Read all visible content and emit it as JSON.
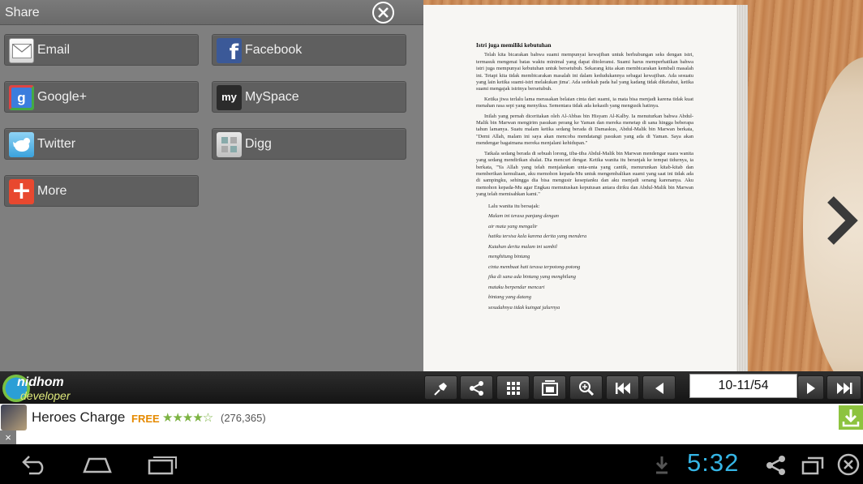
{
  "share_panel": {
    "title": "Share",
    "items": [
      {
        "label": "Email",
        "icon": "email-icon"
      },
      {
        "label": "Facebook",
        "icon": "facebook-icon"
      },
      {
        "label": "Google+",
        "icon": "google-plus-icon"
      },
      {
        "label": "MySpace",
        "icon": "myspace-icon"
      },
      {
        "label": "Twitter",
        "icon": "twitter-icon"
      },
      {
        "label": "Digg",
        "icon": "digg-icon"
      },
      {
        "label": "More",
        "icon": "plus-icon"
      }
    ],
    "icon_glyphs": {
      "facebook": "f",
      "google_plus": "g",
      "myspace": "my",
      "more": "+"
    }
  },
  "book": {
    "heading": "Istri juga memiliki kebutuhan",
    "paragraphs": [
      "Telah kita bicarakan bahwa suami mempunyai kewajiban untuk berhubungan seks dengan istri, termasuk mengenai batas waktu minimal yang dapat ditoleransi. Suami harus memperhatikan bahwa istri juga mempunyai kebutuhan untuk bersetubuh. Sekarang kita akan membicarakan kembali masalah ini. Tetapi kita tidak membicarakan masalah ini dalam kedudukannya sebagai kewajiban. Ada sesuatu yang lain ketika suami-istri melakukan jima'. Ada sedekah pada hal yang kadang tidak diketahui, ketika suami mengajak istrinya bersetubuh.",
      "Ketika jiwa terlalu lama merasakan belaian cinta dari suami, ia mata bisa menjadi karena tidak kuat menahan rasa sepi yang menyiksa. Sementara tidak ada kekasih yang mengusik hatinya.",
      "Inilah yang pernah diceritakan oleh Al-Abbas bin Hisyam Al-Kalby. Ia menuturkan bahwa Abdul-Malik bin Marwan mengirim pasukan perang ke Yaman dan mereka menetap di sana hingga beberapa tahun lamanya. Suatu malam ketika sedang berada di Damaskus, Abdul-Malik bin Marwan berkata, \"Demi Allah, malam ini saya akan mencoba mendatangi pasukan yang ada di Yaman. Saya akan mendengar bagaimana mereka menjalani kehidupan.\"",
      "Tatkala sedang berada di sebuah lorong, tiba-tiba Abdul-Malik bin Marwan mendengar suara wanita yang sedang mendirikan shalat. Dia mencuri dengar. Ketika wanita itu beranjak ke tempat tidurnya, ia berkata, \"Ya Allah yang telah menjalankan unta-unta yang cantik, menurunkan kitab-kitab dan memberikan kemuliaan, aku memohon kepada-Mu untuk mengembalikan suami yang saat ini tidak ada di sampingku, sehingga dia bisa mengusir kesepianku dan aku menjadi senang karenanya. Aku memohon kepada-Mu agar Engkau memutuskan keputusan antara diriku dan Abdul-Malik bin Marwan yang telah memisahkan kami.\""
    ],
    "poem_intro": "Lalu wanita itu bersajak:",
    "poem": [
      "Malam ini terasa panjang dengan",
      "air mata yang mengalir",
      "hatiku tersisa kala karena derita yang mendera",
      "Kutahan derita malam ini sambil",
      "menghitung bintang",
      "cinta membuat hati terasa terpotong-potong",
      "jika di sana ada bintang yang menghilang",
      "mataku berpendar mencari",
      "bintang yang datang",
      "sesudahnya tidak kuingat jalurnya"
    ]
  },
  "toolbar": {
    "logo_line1": "nidhom",
    "logo_line2": "developer",
    "page_indicator": "10-11/54",
    "buttons": [
      "pin-icon",
      "share-icon",
      "grid-icon",
      "pages-icon",
      "zoom-icon",
      "first-page-icon",
      "prev-page-icon",
      "next-page-icon",
      "last-page-icon"
    ]
  },
  "ad": {
    "title": "Heroes Charge",
    "price": "FREE",
    "stars": "★★★★☆",
    "rating_count": "(276,365)",
    "close": "×"
  },
  "status": {
    "clock": "5:32"
  },
  "colors": {
    "accent_clock": "#35b5e5",
    "panel_bg": "#7f7f7f",
    "button_bg": "#5f5f5f",
    "download_green": "#8dc33f",
    "free_orange": "#e58a00"
  }
}
